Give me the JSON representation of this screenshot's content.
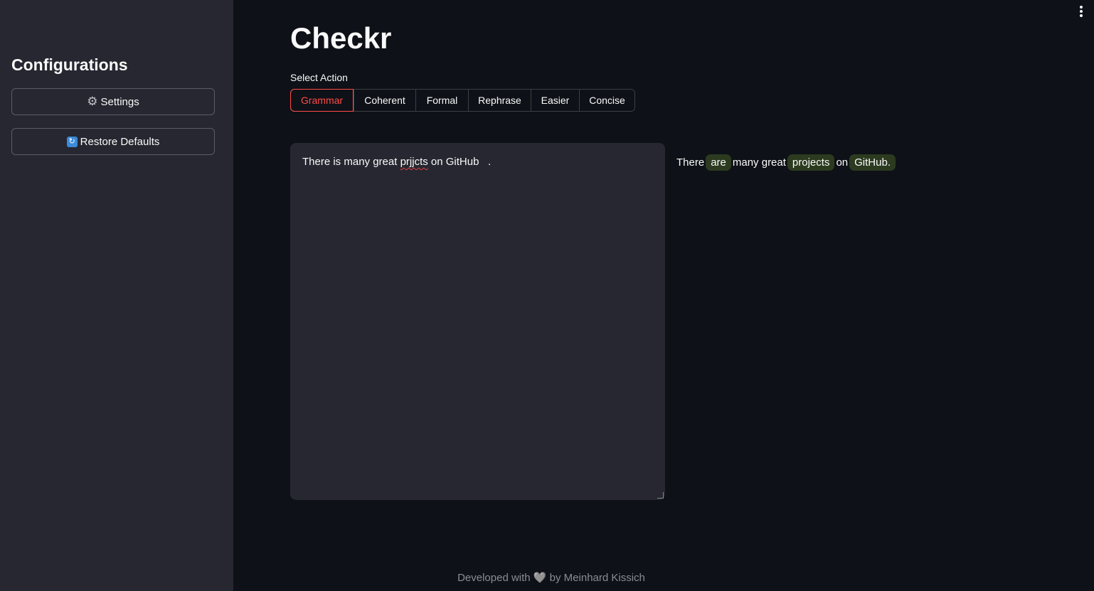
{
  "sidebar": {
    "title": "Configurations",
    "settings_icon": "⚙",
    "settings_label": "Settings",
    "restore_icon": "🔄",
    "restore_label": "Restore Defaults"
  },
  "main": {
    "title": "Checkr",
    "select_label": "Select Action",
    "actions": [
      "Grammar",
      "Coherent",
      "Formal",
      "Rephrase",
      "Easier",
      "Concise"
    ],
    "active_action": "Grammar",
    "input": {
      "before": "There is many great ",
      "misspelled": "prjjcts",
      "after": " on GitHub   ."
    },
    "result": {
      "w1": "There",
      "h1": "are",
      "w2": "many great",
      "h2": "projects",
      "w3": "on",
      "h3": "GitHub."
    }
  },
  "footer": {
    "prefix": "Developed with",
    "heart": "🩶",
    "suffix": "by Meinhard Kissich"
  },
  "colors": {
    "primary": "#ff4b4b",
    "background": "#0e1117",
    "sidebar": "#262730",
    "highlight": "#2c3b1f"
  }
}
